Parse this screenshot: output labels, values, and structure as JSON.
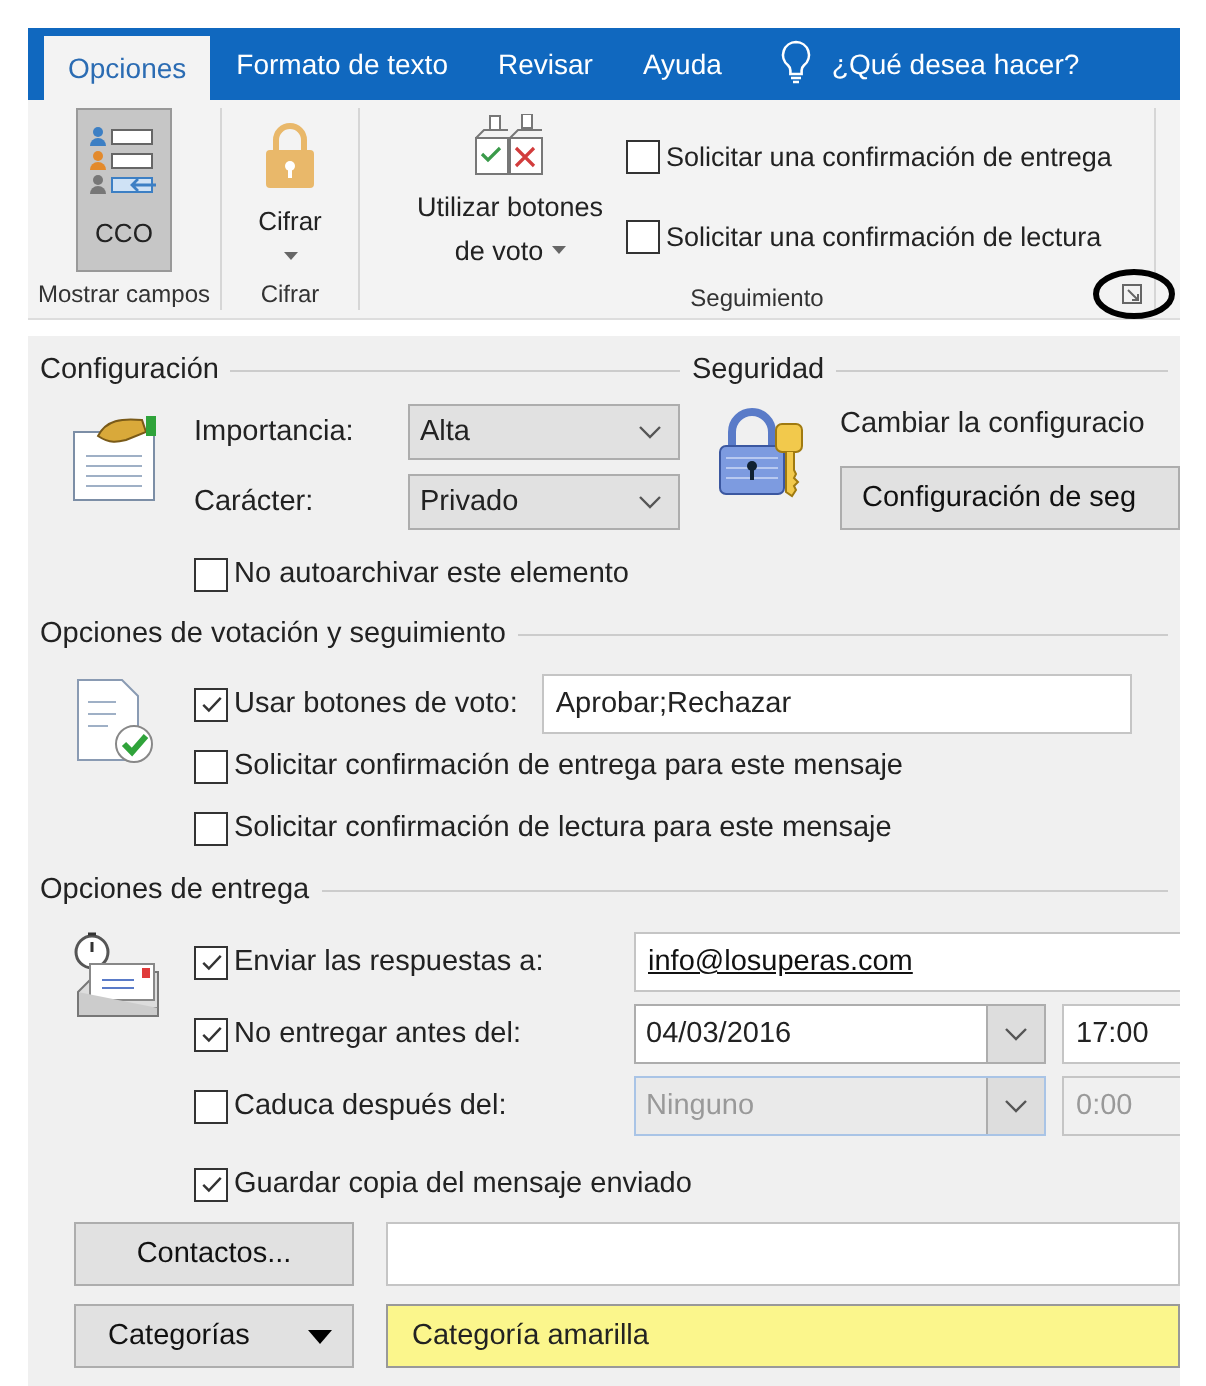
{
  "ribbon": {
    "tabs": [
      {
        "label": "Opciones",
        "selected": true
      },
      {
        "label": "Formato de texto",
        "selected": false
      },
      {
        "label": "Revisar",
        "selected": false
      },
      {
        "label": "Ayuda",
        "selected": false
      }
    ],
    "tell_me": "¿Qué desea hacer?",
    "groups": [
      {
        "kind": "fields",
        "label": "Mostrar campos",
        "button": "CCO",
        "selected": true
      },
      {
        "kind": "encrypt",
        "label": "Cifrar",
        "button": "Cifrar"
      },
      {
        "kind": "tracking",
        "label": "Seguimiento",
        "button": "Utilizar botones de voto",
        "checks": [
          {
            "label": "Solicitar una confirmación de entrega",
            "checked": false
          },
          {
            "label": "Solicitar una confirmación de lectura",
            "checked": false
          }
        ]
      }
    ]
  },
  "configuracion": {
    "title": "Configuración",
    "importance": {
      "label": "Importancia:",
      "value": "Alta"
    },
    "character": {
      "label": "Carácter:",
      "value": "Privado"
    },
    "no_archive": {
      "label": "No autoarchivar este elemento",
      "checked": false
    }
  },
  "seguridad": {
    "title": "Seguridad",
    "text": "Cambiar la configuracio",
    "button": "Configuración de seg"
  },
  "votacion": {
    "title": "Opciones de votación y seguimiento",
    "use_vote": {
      "label": "Usar botones de voto:",
      "checked": true,
      "value": "Aprobar;Rechazar"
    },
    "checks": [
      {
        "label": "Solicitar confirmación de entrega para este mensaje",
        "checked": false
      },
      {
        "label": "Solicitar confirmación de lectura para este mensaje",
        "checked": false
      }
    ]
  },
  "entrega": {
    "title": "Opciones de entrega",
    "replies": {
      "label": "Enviar las respuestas a:",
      "checked": true,
      "value": "info@losuperas.com"
    },
    "not_before": {
      "label": "No entregar antes del:",
      "checked": true,
      "date": "04/03/2016",
      "time": "17:00"
    },
    "expires": {
      "label": "Caduca después del:",
      "checked": false,
      "date": "Ninguno",
      "time": "0:00"
    },
    "save_copy": {
      "label": "Guardar copia del mensaje enviado",
      "checked": true
    }
  },
  "contacts": {
    "button": "Contactos..."
  },
  "categories": {
    "button": "Categorías",
    "value": "Categoría amarilla"
  }
}
